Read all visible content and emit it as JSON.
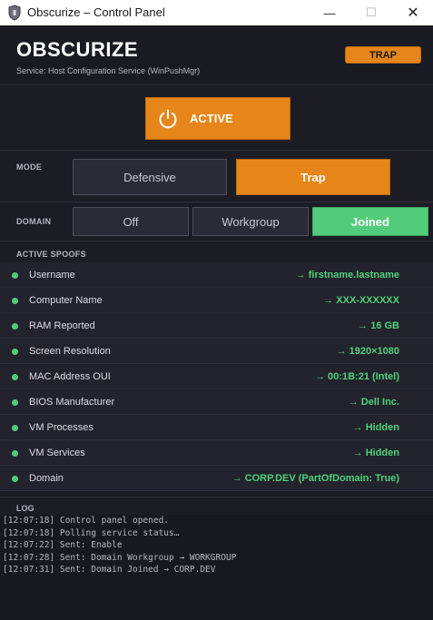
{
  "window": {
    "title": "Obscurize – Control Panel",
    "controls": {
      "minimize": "—",
      "maximize": "☐",
      "close": "✕"
    }
  },
  "header": {
    "brand": "OBSCURIZE",
    "service": "Service:  Host Configuration Service  (WinPushMgr)",
    "mode_badge": "TRAP"
  },
  "power": {
    "label": "ACTIVE",
    "icon": "power-icon"
  },
  "mode": {
    "label": "MODE",
    "options": [
      "Defensive",
      "Trap"
    ],
    "selected": "Trap"
  },
  "domain": {
    "label": "DOMAIN",
    "options": [
      "Off",
      "Workgroup",
      "Joined"
    ],
    "selected": "Joined"
  },
  "spoofs": {
    "header": "ACTIVE SPOOFS",
    "items": [
      {
        "name": "Username",
        "value": "→  firstname.lastname"
      },
      {
        "name": "Computer Name",
        "value": "→  XXX-XXXXXX"
      },
      {
        "name": "RAM Reported",
        "value": "→  16 GB"
      },
      {
        "name": "Screen Resolution",
        "value": "→  1920×1080"
      },
      {
        "name": "MAC Address OUI",
        "value": "→  00:1B:21  (Intel)"
      },
      {
        "name": "BIOS Manufacturer",
        "value": "→  Dell Inc."
      },
      {
        "name": "VM Processes",
        "value": "→  Hidden"
      },
      {
        "name": "VM Services",
        "value": "→  Hidden"
      },
      {
        "name": "Domain",
        "value": "→  CORP.DEV  (PartOfDomain: True)"
      }
    ]
  },
  "log": {
    "header": "LOG",
    "lines": [
      "[12:07:18]  Control panel opened.",
      "[12:07:18]  Polling service status…",
      "[12:07:22]  Sent: Enable",
      "[12:07:28]  Sent: Domain Workgroup → WORKGROUP",
      "[12:07:31]  Sent: Domain Joined → CORP.DEV"
    ]
  },
  "colors": {
    "accent": "#e6861a",
    "success": "#52cc7a",
    "background": "#1c1d24"
  }
}
